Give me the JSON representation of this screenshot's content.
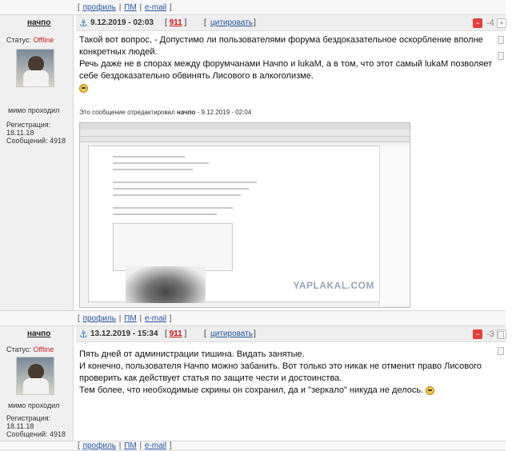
{
  "links": {
    "profile": "профиль",
    "pm": "ПМ",
    "email": "e-mail"
  },
  "posts": [
    {
      "username": "начпо",
      "status_label": "Статус:",
      "status_value": "Offline",
      "user_label": "мимо проходил",
      "reg_label": "Регистрация:",
      "reg_date": "18.11.18",
      "messages": "Сообщений: 4918",
      "date": "9.12.2019 - 02:03",
      "number": "911",
      "quote": "цитировать",
      "rating": "-4",
      "text": [
        "Такой вот вопрос, - Допустимо ли пользователями форума бездоказательное оскорбление вполне конкретных людей.",
        "Речь даже не в спорах между форумчанами Начпо и lukaM, а в том, что этот самый lukaM позволяет себе бездоказательно обвинять Лисового в алкоголизме."
      ],
      "edited_prefix": "Это сообщение отредактировал",
      "edited_user": "начпо",
      "edited_date": "9.12.2019 - 02:04",
      "watermark": "YAPLAKAL.COM"
    },
    {
      "username": "начпо",
      "status_label": "Статус:",
      "status_value": "Offline",
      "user_label": "мимо проходил",
      "reg_label": "Регистрация:",
      "reg_date": "18.11.18",
      "messages": "Сообщений: 4918",
      "date": "13.12.2019 - 15:34",
      "number": "911",
      "quote": "цитировать",
      "rating": "-3",
      "text": [
        "Пять дней от администрации тишина. Видать занятые.",
        "И конечно, пользователя Начпо можно забанить. Вот только это никак не отменит право Лисового проверить как действует статья по защите чести и достоинства.",
        "Тем более, что необходимые скрины он сохранил, да и \"зеркало\" никуда не делось."
      ]
    }
  ],
  "colors": {
    "offline": "#cc2222",
    "link": "#2455a0",
    "number": "#d11111",
    "minus": "#e63d3d"
  }
}
